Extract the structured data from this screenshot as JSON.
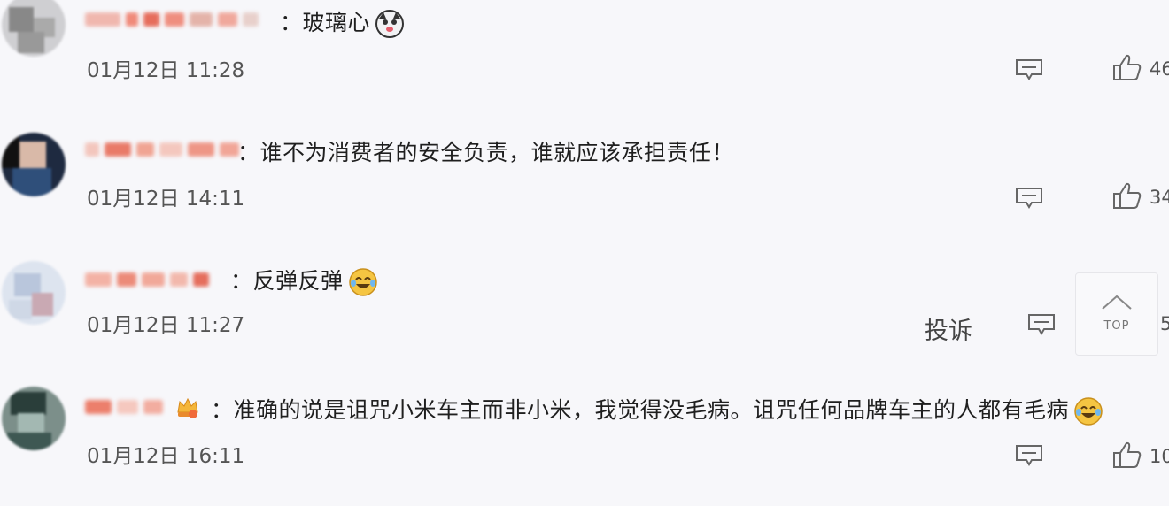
{
  "comments": [
    {
      "text": "：玻璃心",
      "time": "01月12日 11:28",
      "likes": "46",
      "emoji": "dog-face-emoji"
    },
    {
      "text": "：谁不为消费者的安全负责，谁就应该承担责任！",
      "time": "01月12日 14:11",
      "likes": "34",
      "emoji": ""
    },
    {
      "text": "：反弹反弹",
      "time": "01月12日 11:27",
      "likes": "5",
      "emoji": "laughing-crying-emoji"
    },
    {
      "text": "：准确的说是诅咒小米车主而非小米，我觉得没毛病。诅咒任何品牌车主的人都有毛病",
      "time": "01月12日 16:11",
      "likes": "10",
      "emoji": "laughing-crying-emoji"
    }
  ],
  "actions": {
    "report_label": "投诉",
    "top_label": "TOP"
  },
  "colors": {
    "background": "#f7f7fa",
    "icon_stroke": "#666666",
    "emoji_yellow": "#f5c542"
  }
}
